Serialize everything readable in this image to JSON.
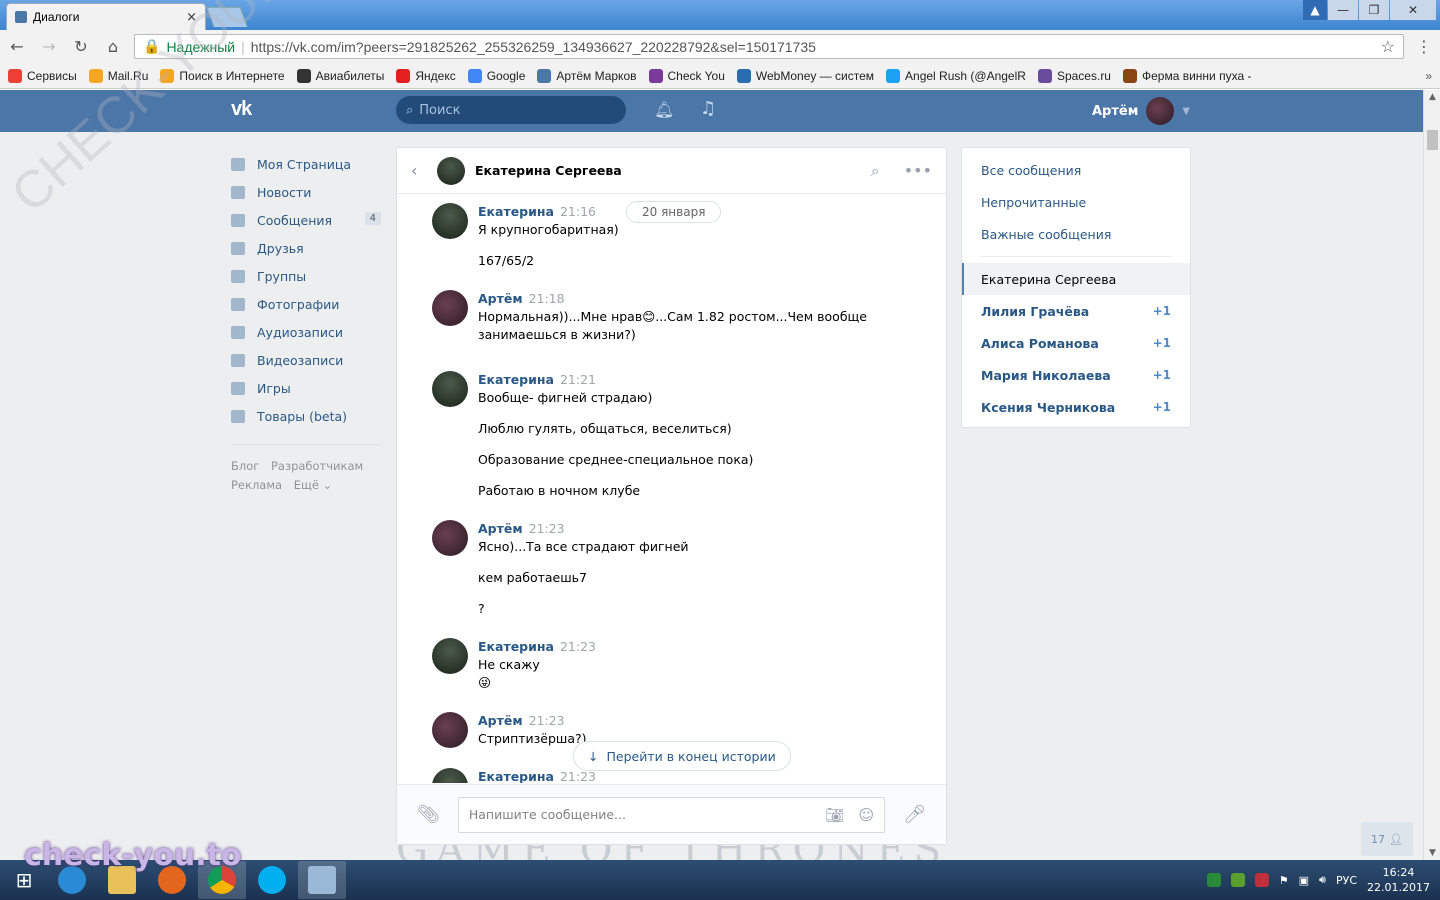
{
  "browser": {
    "tab_title": "Диалоги",
    "tab_close": "×",
    "window_buttons": [
      "▲",
      "—",
      "❐",
      "✕"
    ],
    "secure_label": "Надежный",
    "url": "https://vk.com/im?peers=291825262_255326259_134936627_220228792&sel=150171735",
    "bookmarks": [
      {
        "label": "Сервисы",
        "icon": "apps-icon",
        "color": "#e94235"
      },
      {
        "label": "Mail.Ru",
        "icon": "mailru-icon",
        "color": "#f5a623"
      },
      {
        "label": "Поиск в Интернете",
        "icon": "search-web-icon",
        "color": "#f5a623"
      },
      {
        "label": "Авиабилеты",
        "icon": "plane-icon",
        "color": "#333333"
      },
      {
        "label": "Яндекс",
        "icon": "yandex-icon",
        "color": "#e32020"
      },
      {
        "label": "Google",
        "icon": "google-icon",
        "color": "#4285f4"
      },
      {
        "label": "Артём Марков",
        "icon": "vk-icon",
        "color": "#4a76a8"
      },
      {
        "label": "Check You",
        "icon": "check-you-icon",
        "color": "#7a3a9a"
      },
      {
        "label": "WebMoney — систем",
        "icon": "webmoney-icon",
        "color": "#2a6db0"
      },
      {
        "label": "Angel Rush (@AngelR",
        "icon": "twitter-icon",
        "color": "#1da1f2"
      },
      {
        "label": "Spaces.ru",
        "icon": "spaces-icon",
        "color": "#6a4c9c"
      },
      {
        "label": "Ферма винни пуха -",
        "icon": "game-icon",
        "color": "#8b4513"
      }
    ],
    "bookmarks_more": "»"
  },
  "vk": {
    "logo": "vk",
    "search_placeholder": "Поиск",
    "user_name": "Артём",
    "left_nav": [
      {
        "label": "Моя Страница",
        "icon": "home-icon"
      },
      {
        "label": "Новости",
        "icon": "news-icon"
      },
      {
        "label": "Сообщения",
        "icon": "messages-icon",
        "badge": "4"
      },
      {
        "label": "Друзья",
        "icon": "friends-icon"
      },
      {
        "label": "Группы",
        "icon": "groups-icon"
      },
      {
        "label": "Фотографии",
        "icon": "photos-icon"
      },
      {
        "label": "Аудиозаписи",
        "icon": "audio-icon"
      },
      {
        "label": "Видеозаписи",
        "icon": "video-icon"
      },
      {
        "label": "Игры",
        "icon": "games-icon"
      },
      {
        "label": "Товары (beta)",
        "icon": "market-icon"
      }
    ],
    "footer_links": [
      "Блог",
      "Разработчикам",
      "Реклама",
      "Ещё ⌄"
    ]
  },
  "chat": {
    "title": "Екатерина Сергеева",
    "date_divider": "20 января",
    "jump_button": "Перейти в конец истории",
    "composer_placeholder": "Напишите сообщение...",
    "messages": [
      {
        "author": "Екатерина",
        "time": "21:16",
        "lines": [
          "Я крупногобаритная)",
          "167/65/2"
        ]
      },
      {
        "author": "Артём",
        "time": "21:18",
        "lines": [
          "Нормальная))...Мне нрав😊...Сам 1.82 ростом...Чем вообще занимаешься в жизни?)"
        ]
      },
      {
        "author": "Екатерина",
        "time": "21:21",
        "lines": [
          "Вообще- фигней страдаю)",
          "Люблю гулять, общаться, веселиться)",
          "Образование среднее-специальное пока)",
          "Работаю в ночном клубе"
        ]
      },
      {
        "author": "Артём",
        "time": "21:23",
        "lines": [
          "Ясно)...Та все страдают фигней",
          "кем работаешь7",
          "?"
        ]
      },
      {
        "author": "Екатерина",
        "time": "21:23",
        "lines": [
          "Не скажу",
          "😜"
        ]
      },
      {
        "author": "Артём",
        "time": "21:23",
        "lines": [
          "Стриптизёрша?)"
        ]
      },
      {
        "author": "Екатерина",
        "time": "21:23",
        "lines": []
      }
    ]
  },
  "right_panel": {
    "filters": [
      "Все сообщения",
      "Непрочитанные",
      "Важные сообщения"
    ],
    "conversations": [
      {
        "name": "Екатерина Сергеева",
        "count": "",
        "active": true
      },
      {
        "name": "Лилия Грачёва",
        "count": "+1"
      },
      {
        "name": "Алиса Романова",
        "count": "+1"
      },
      {
        "name": "Мария Николаева",
        "count": "+1"
      },
      {
        "name": "Ксения Черникова",
        "count": "+1"
      }
    ]
  },
  "float_counter": "17",
  "background_text": "GAME OF THRONES",
  "watermarks": [
    "check-you.to",
    "CHECK-YOU.ME"
  ],
  "taskbar": {
    "language": "РУС",
    "time": "16:24",
    "date": "22.01.2017"
  }
}
